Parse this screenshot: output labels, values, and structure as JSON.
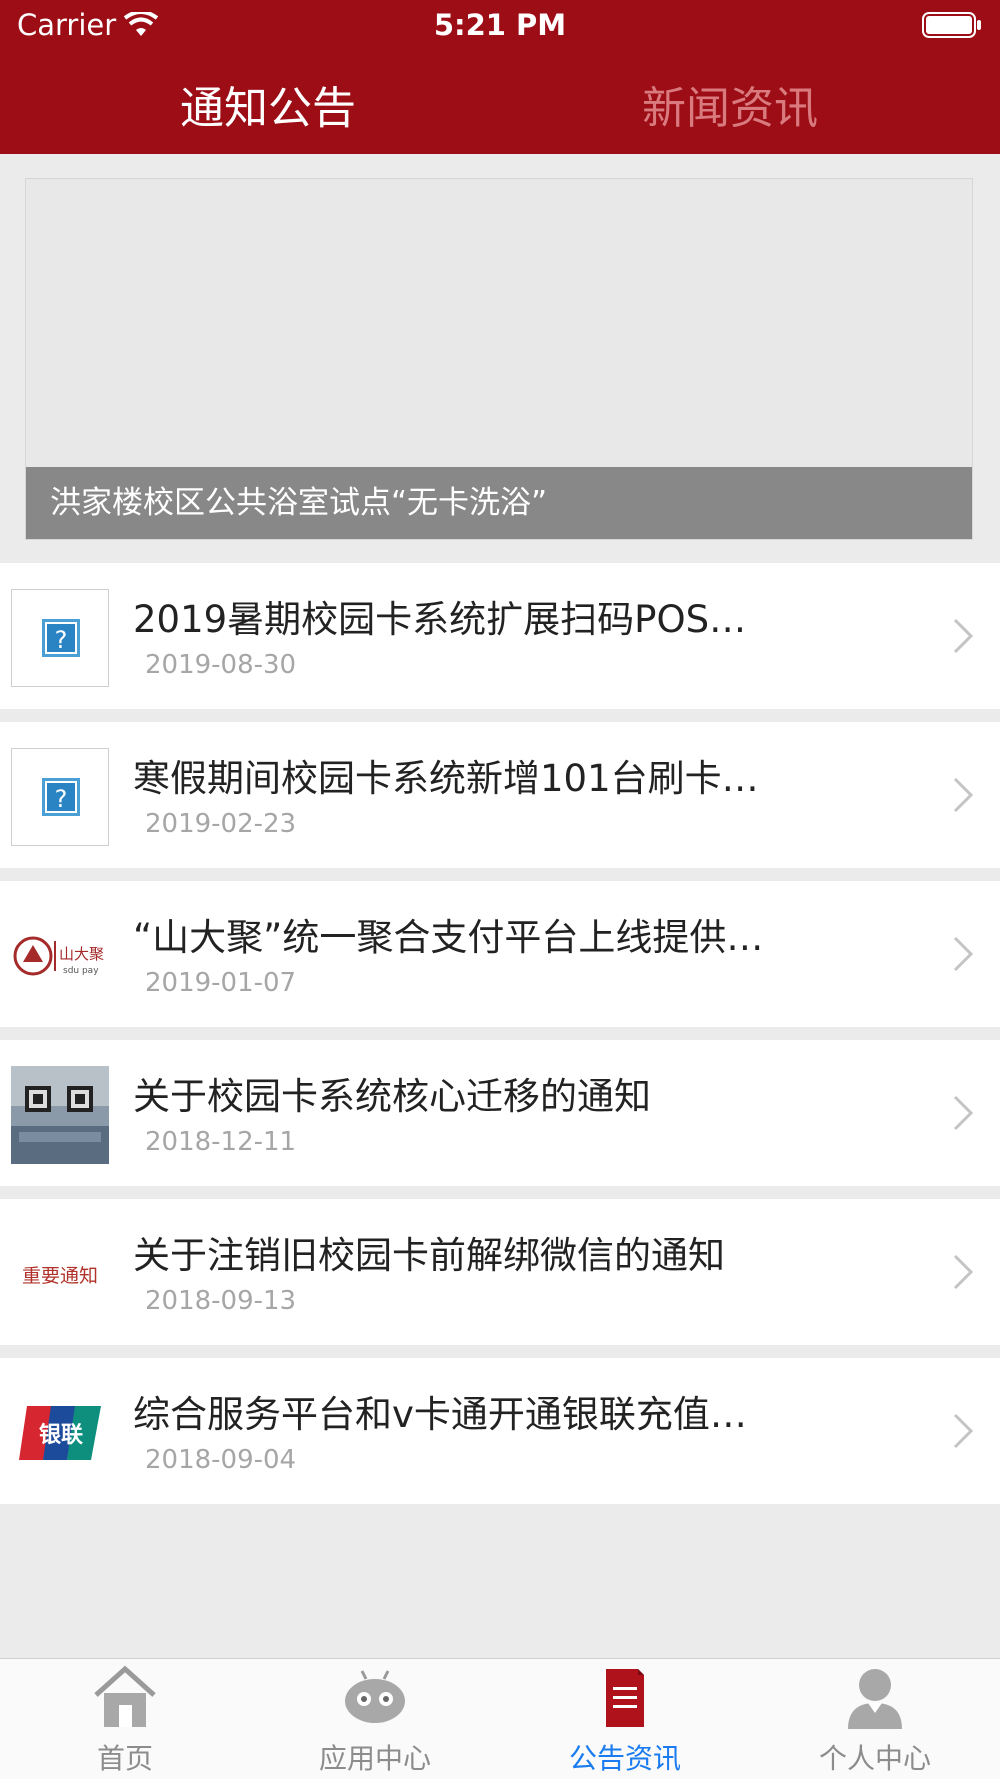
{
  "status_bar": {
    "carrier": "Carrier",
    "time": "5:21 PM"
  },
  "tabs": [
    {
      "label": "通知公告",
      "active": true
    },
    {
      "label": "新闻资讯",
      "active": false
    }
  ],
  "banner": {
    "caption": "洪家楼校区公共浴室试点“无卡洗浴”"
  },
  "items": [
    {
      "title": "2019暑期校园卡系统扩展扫码POS…",
      "date": "2019-08-30",
      "thumb": "question-icon"
    },
    {
      "title": "寒假期间校园卡系统新增101台刷卡…",
      "date": "2019-02-23",
      "thumb": "question-icon"
    },
    {
      "title": "“山大聚”统一聚合支付平台上线提供…",
      "date": "2019-01-07",
      "thumb": "sdupay-logo",
      "thumb_text": "山大聚",
      "thumb_sub": "sdu pay"
    },
    {
      "title": "关于校园卡系统核心迁移的通知",
      "date": "2018-12-11",
      "thumb": "qr-photo"
    },
    {
      "title": "关于注销旧校园卡前解绑微信的通知",
      "date": "2018-09-13",
      "thumb": "notice-stamp",
      "thumb_text": "重要通知"
    },
    {
      "title": "综合服务平台和v卡通开通银联充值…",
      "date": "2018-09-04",
      "thumb": "unionpay-logo",
      "thumb_text": "银联"
    }
  ],
  "tabbar": [
    {
      "label": "首页",
      "icon": "home-icon",
      "active": false
    },
    {
      "label": "应用中心",
      "icon": "robot-icon",
      "active": false
    },
    {
      "label": "公告资讯",
      "icon": "document-icon",
      "active": true
    },
    {
      "label": "个人中心",
      "icon": "user-icon",
      "active": false
    }
  ],
  "colors": {
    "header": "#9c0d16",
    "active_tab_text": "#1a7cf0",
    "background": "#ebebeb"
  }
}
